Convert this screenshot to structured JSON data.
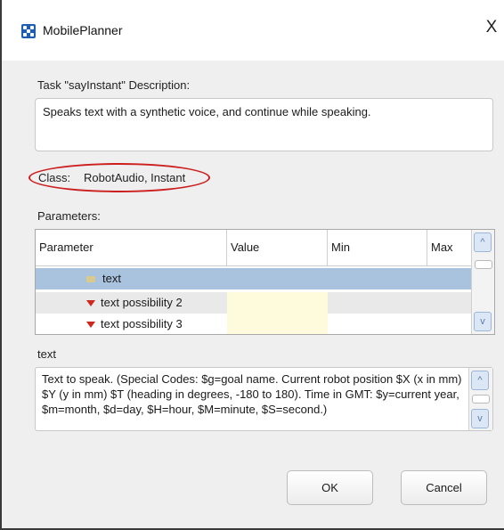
{
  "window": {
    "title": "MobilePlanner",
    "close_glyph": "X",
    "app_icon": "mobileplanner-app-icon"
  },
  "task": {
    "description_label": "Task \"sayInstant\" Description:",
    "description": "Speaks text with a synthetic voice, and continue while speaking."
  },
  "class_info": {
    "label": "Class:",
    "value": "RobotAudio, Instant",
    "highlight_color": "#cc1f1f"
  },
  "parameters": {
    "label": "Parameters:",
    "columns": [
      "Parameter",
      "Value",
      "Min",
      "Max"
    ],
    "rows": [
      {
        "name": "text",
        "icon": "folder-icon",
        "value": "",
        "min": "",
        "max": "",
        "selected": true
      },
      {
        "name": "text possibility 2",
        "icon": "red-triangle-icon",
        "value": "",
        "min": "",
        "max": "",
        "selected": false
      },
      {
        "name": "text possibility 3",
        "icon": "red-triangle-icon",
        "value": "",
        "min": "",
        "max": "",
        "selected": false
      }
    ],
    "selected_row_color": "#a9c3df"
  },
  "help": {
    "label": "text",
    "text": "Text to speak. (Special Codes: $g=goal name. Current robot position $X (x in mm) $Y (y in mm) $T (heading in degrees, -180 to 180). Time in GMT: $y=current year, $m=month, $d=day, $H=hour, $M=minute, $S=second.)"
  },
  "buttons": {
    "ok": "OK",
    "cancel": "Cancel"
  },
  "scroll": {
    "up_glyph": "^",
    "down_glyph": "v"
  }
}
